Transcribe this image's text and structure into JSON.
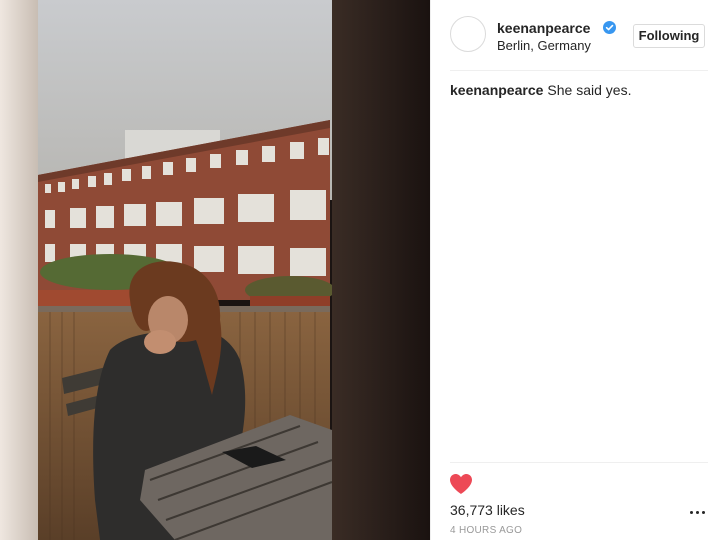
{
  "post": {
    "username": "keenanpearce",
    "location": "Berlin, Germany",
    "follow_label": "Following",
    "caption_user": "keenanpearce",
    "caption_text": "She said yes.",
    "likes": "36,773 likes",
    "time": "4 HOURS AGO"
  },
  "icons": {
    "verified": "verified-badge-icon",
    "heart": "heart-icon",
    "more": "more-options-icon"
  },
  "colors": {
    "heart": "#ed4956",
    "verified": "#3897f0",
    "text": "#262626",
    "muted": "#999999"
  }
}
